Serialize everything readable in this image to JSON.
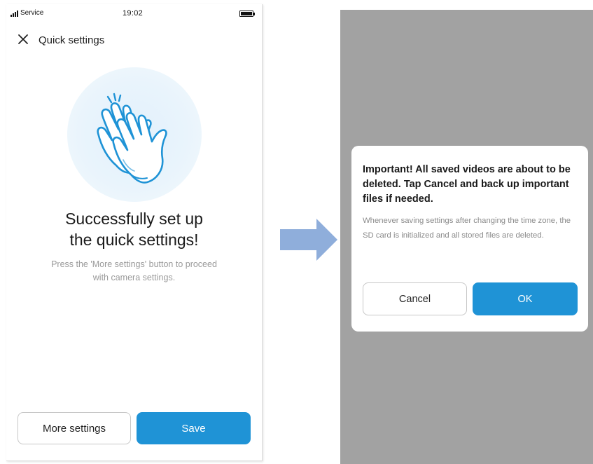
{
  "status_bar": {
    "carrier": "Service",
    "time": "19:02"
  },
  "header": {
    "title": "Quick settings"
  },
  "success": {
    "title_line1": "Successfully set up",
    "title_line2": "the quick settings!",
    "desc_line1": "Press the 'More settings' button to proceed",
    "desc_line2": "with camera settings."
  },
  "buttons": {
    "more_settings": "More settings",
    "save": "Save"
  },
  "dialog": {
    "title": "Important!  All saved videos are about to be deleted. Tap Cancel and back up important files if needed.",
    "body": "Whenever saving settings after changing the time zone, the SD card is initialized and all stored files are deleted.",
    "cancel": "Cancel",
    "ok": "OK"
  },
  "icons": {
    "close": "close-icon",
    "clapping": "clapping-hands-icon",
    "arrow": "right-arrow-icon",
    "signal": "signal-icon",
    "battery": "battery-icon"
  },
  "colors": {
    "accent": "#1f93d6",
    "arrow": "#8faedb",
    "overlay": "#a2a2a2",
    "illustration_bg": "#e6f2fb"
  }
}
